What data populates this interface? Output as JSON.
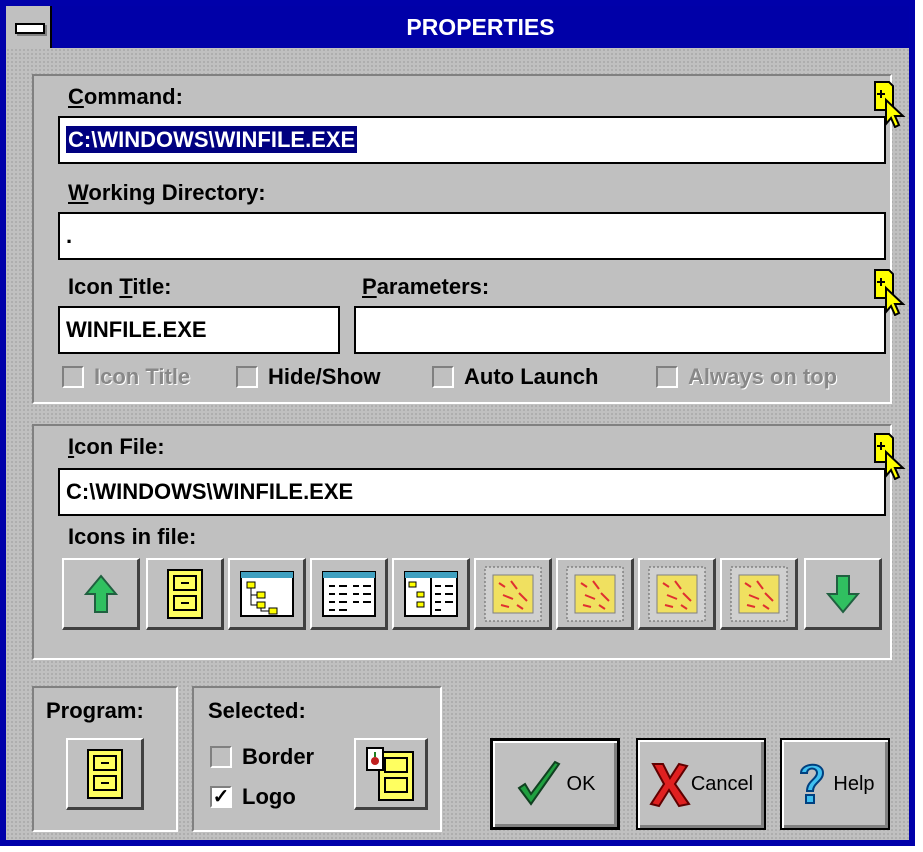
{
  "window": {
    "title": "PROPERTIES"
  },
  "program_panel": {
    "command_label_accel": "C",
    "command_label_rest": "ommand:",
    "command_value": "C:\\WINDOWS\\WINFILE.EXE",
    "workdir_label_accel": "W",
    "workdir_label_rest": "orking Directory:",
    "workdir_value": ".",
    "icon_title_label_pre": "Icon ",
    "icon_title_label_accel": "T",
    "icon_title_label_rest": "itle:",
    "icon_title_value": "WINFILE.EXE",
    "parameters_label_accel": "P",
    "parameters_label_rest": "arameters:",
    "parameters_value": "",
    "checkboxes": [
      {
        "label": "Icon Title",
        "checked": false,
        "enabled": false
      },
      {
        "label": "Hide/Show",
        "checked": false,
        "enabled": true
      },
      {
        "label": "Auto Launch",
        "checked": false,
        "enabled": true
      },
      {
        "label": "Always on top",
        "checked": false,
        "enabled": false
      }
    ]
  },
  "icon_panel": {
    "icon_file_label_accel": "I",
    "icon_file_label_rest": "con File:",
    "icon_file_value": "C:\\WINDOWS\\WINFILE.EXE",
    "icons_label": "Icons in file:",
    "icons": [
      "arrow-up-icon",
      "file-cabinet-icon",
      "tree-view-icon",
      "file-list-icon",
      "tree-list-icon",
      "no-icon-placeholder",
      "no-icon-placeholder",
      "no-icon-placeholder",
      "no-icon-placeholder",
      "arrow-down-icon"
    ]
  },
  "program_box": {
    "label": "Program:"
  },
  "selected_box": {
    "label": "Selected:",
    "border_label": "Border",
    "border_checked": false,
    "logo_label": "Logo",
    "logo_checked": true,
    "check_mark": "✓"
  },
  "buttons": {
    "ok": "OK",
    "cancel": "Cancel",
    "help": "Help"
  },
  "colors": {
    "titlebar": "#0000a8",
    "face": "#c0c0c0",
    "selection": "#000080"
  }
}
